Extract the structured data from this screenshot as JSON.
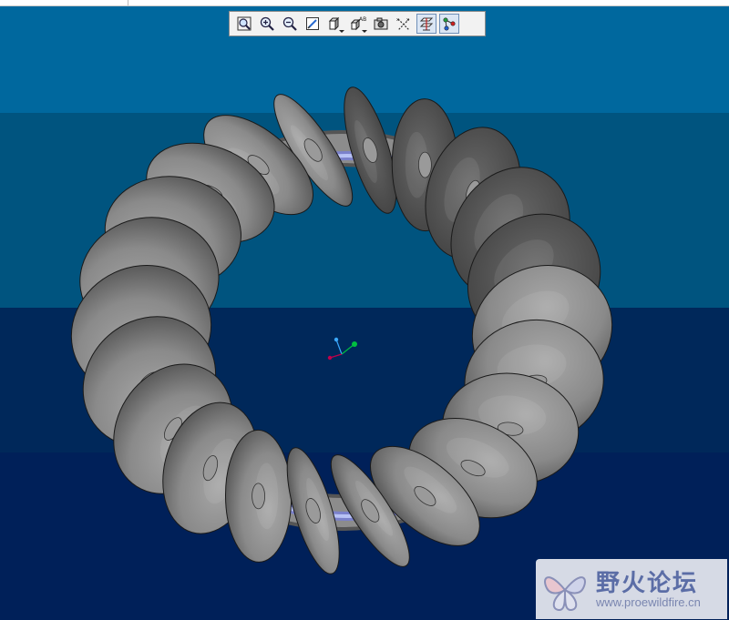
{
  "viewport": {
    "bands": [
      {
        "color": "#00689e"
      },
      {
        "color": "#00547f"
      },
      {
        "color": "#00285a"
      },
      {
        "color": "#002059"
      }
    ],
    "blade_colors": {
      "light": "#a8a8a8",
      "mid": "#8a8a8a",
      "dark": "#565656",
      "edge": "#1a1a1a"
    },
    "ring_colors": {
      "base": "#8c8c8c",
      "highlight": "#c8d2ff",
      "glow": "#6e78ff"
    },
    "triad_colors": {
      "x": "#c0004a",
      "y": "#00c040",
      "z": "#3aa8ff"
    }
  },
  "toolbar": {
    "buttons": [
      {
        "id": "refit",
        "icon": "zoom-refit-icon",
        "active": false
      },
      {
        "id": "zoom-in",
        "icon": "zoom-in-icon",
        "active": false
      },
      {
        "id": "zoom-out",
        "icon": "zoom-out-icon",
        "active": false
      },
      {
        "id": "repaint",
        "icon": "repaint-icon",
        "active": false
      },
      {
        "id": "display-style",
        "icon": "display-style-icon",
        "active": false,
        "menu": true
      },
      {
        "id": "saved-views",
        "icon": "saved-views-icon",
        "active": false,
        "menu": true
      },
      {
        "id": "view-manager",
        "icon": "view-manager-icon",
        "active": false
      },
      {
        "id": "datum-axes",
        "icon": "datum-axes-icon",
        "active": false
      },
      {
        "id": "datum-planes",
        "icon": "datum-planes-icon",
        "active": true
      },
      {
        "id": "datum-points",
        "icon": "datum-points-icon",
        "active": true
      }
    ]
  },
  "watermark": {
    "title": "野火论坛",
    "url": "www.proewildfire.cn"
  }
}
